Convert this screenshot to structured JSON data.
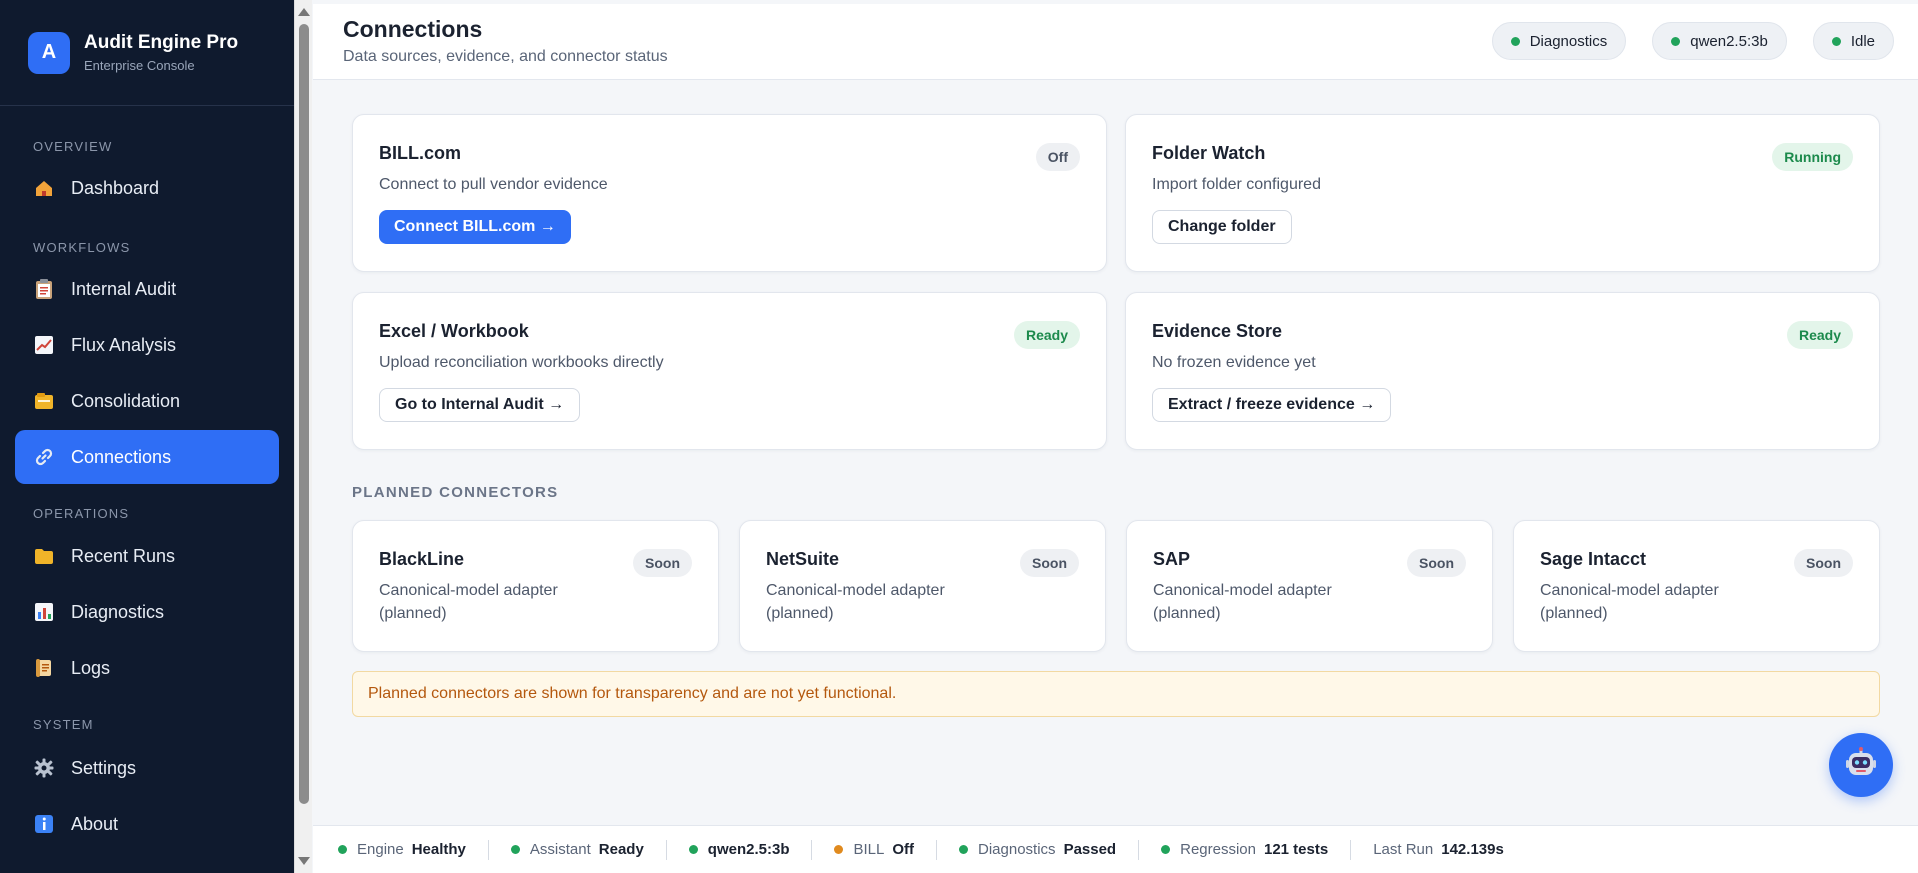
{
  "brand": {
    "logo_letter": "A",
    "title": "Audit Engine Pro",
    "subtitle": "Enterprise Console"
  },
  "sidebar": {
    "groups": [
      {
        "label": "OVERVIEW",
        "items": [
          {
            "label": "Dashboard",
            "icon": "house-icon",
            "active": false
          }
        ]
      },
      {
        "label": "WORKFLOWS",
        "items": [
          {
            "label": "Internal Audit",
            "icon": "clipboard-icon",
            "active": false
          },
          {
            "label": "Flux Analysis",
            "icon": "line-chart-icon",
            "active": false
          },
          {
            "label": "Consolidation",
            "icon": "card-box-icon",
            "active": false
          },
          {
            "label": "Connections",
            "icon": "link-icon",
            "active": true
          }
        ]
      },
      {
        "label": "OPERATIONS",
        "items": [
          {
            "label": "Recent Runs",
            "icon": "folder-icon",
            "active": false
          },
          {
            "label": "Diagnostics",
            "icon": "bar-chart-icon",
            "active": false
          },
          {
            "label": "Logs",
            "icon": "scroll-icon",
            "active": false
          }
        ]
      },
      {
        "label": "SYSTEM",
        "items": [
          {
            "label": "Settings",
            "icon": "gear-icon",
            "active": false
          },
          {
            "label": "About",
            "icon": "info-icon",
            "active": false
          }
        ]
      }
    ]
  },
  "header": {
    "title": "Connections",
    "subtitle": "Data sources, evidence, and connector status",
    "pills": [
      "Diagnostics",
      "qwen2.5:3b",
      "Idle"
    ]
  },
  "connections": [
    {
      "title": "BILL.com",
      "desc": "Connect to pull vendor evidence",
      "badge": "Off",
      "button": "Connect BILL.com →"
    },
    {
      "title": "Folder Watch",
      "desc": "Import folder configured",
      "badge": "Running",
      "button": "Change folder"
    },
    {
      "title": "Excel / Workbook",
      "desc": "Upload reconciliation workbooks directly",
      "badge": "Ready",
      "button": "Go to Internal Audit →"
    },
    {
      "title": "Evidence Store",
      "desc": "No frozen evidence yet",
      "badge": "Ready",
      "button": "Extract / freeze evidence →"
    }
  ],
  "planned": {
    "label": "PLANNED CONNECTORS",
    "items": [
      {
        "title": "BlackLine",
        "desc": "Canonical-model adapter (planned)",
        "badge": "Soon"
      },
      {
        "title": "NetSuite",
        "desc": "Canonical-model adapter (planned)",
        "badge": "Soon"
      },
      {
        "title": "SAP",
        "desc": "Canonical-model adapter (planned)",
        "badge": "Soon"
      },
      {
        "title": "Sage Intacct",
        "desc": "Canonical-model adapter (planned)",
        "badge": "Soon"
      }
    ],
    "notice": "Planned connectors are shown for transparency and are not yet functional."
  },
  "status_bar": [
    {
      "key": "Engine",
      "value": "Healthy",
      "dot": "#21a35b"
    },
    {
      "key": "Assistant",
      "value": "Ready",
      "dot": "#21a35b"
    },
    {
      "key": "",
      "value": "qwen2.5:3b",
      "dot": "#21a35b"
    },
    {
      "key": "BILL",
      "value": "Off",
      "dot": "#e08a1e"
    },
    {
      "key": "Diagnostics",
      "value": "Passed",
      "dot": "#21a35b"
    },
    {
      "key": "Regression",
      "value": "121 tests",
      "dot": "#21a35b"
    },
    {
      "key": "Last Run",
      "value": "142.139s",
      "dot": ""
    }
  ],
  "colors": {
    "accent": "#2f6ef5",
    "sidebar_bg": "#0f1a2e",
    "status_ok": "#21a35b",
    "status_warn": "#e08a1e"
  }
}
